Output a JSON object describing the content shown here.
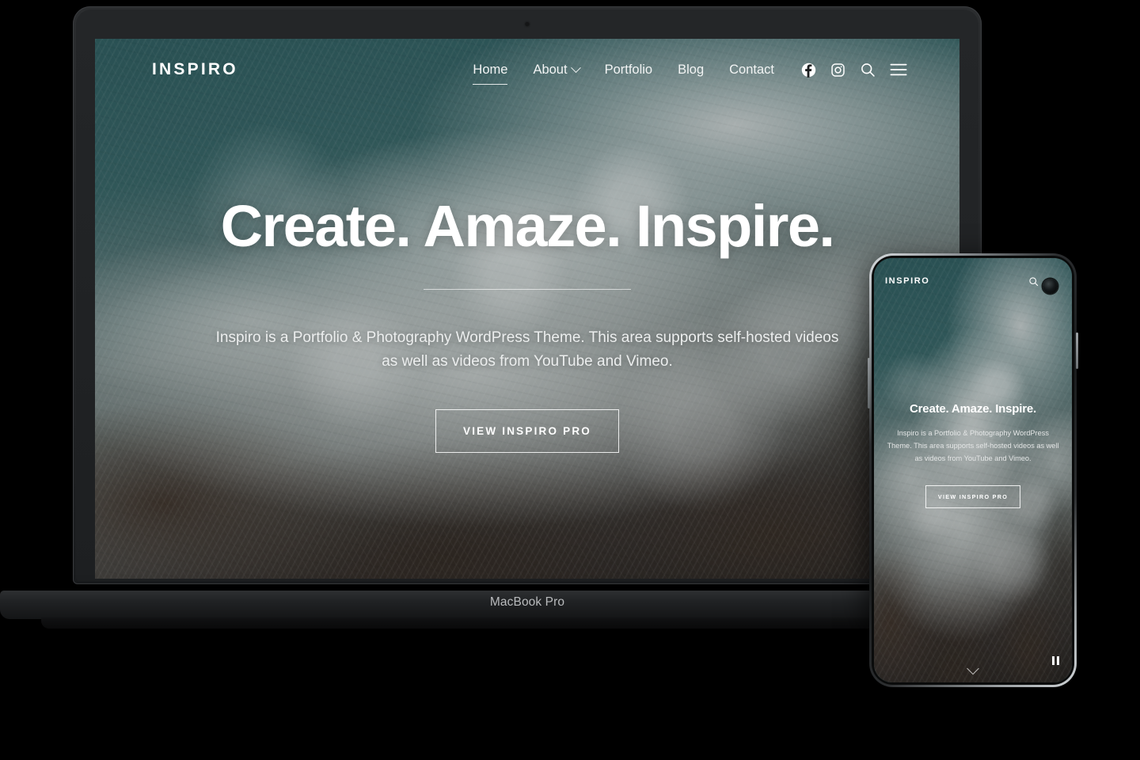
{
  "device_mockup": {
    "laptop_label": "MacBook Pro"
  },
  "site": {
    "brand": "INSPIRO",
    "nav": {
      "links": [
        {
          "label": "Home",
          "active": true,
          "has_dropdown": false
        },
        {
          "label": "About",
          "active": false,
          "has_dropdown": true
        },
        {
          "label": "Portfolio",
          "active": false,
          "has_dropdown": false
        },
        {
          "label": "Blog",
          "active": false,
          "has_dropdown": false
        },
        {
          "label": "Contact",
          "active": false,
          "has_dropdown": false
        }
      ],
      "icons": [
        "facebook-icon",
        "instagram-icon",
        "search-icon",
        "hamburger-menu-icon"
      ]
    },
    "hero": {
      "title": "Create. Amaze. Inspire.",
      "subtitle": "Inspiro is a Portfolio & Photography WordPress Theme. This area supports self-hosted videos as well as videos from YouTube and Vimeo.",
      "cta_label": "VIEW INSPIRO PRO",
      "background": "aerial ocean waves over rocks"
    }
  },
  "mobile": {
    "brand": "INSPIRO",
    "icons": [
      "search-icon"
    ],
    "hero": {
      "title": "Create. Amaze. Inspire.",
      "subtitle": "Inspiro is a Portfolio & Photography WordPress Theme. This area supports self-hosted videos as well as videos from YouTube and Vimeo.",
      "cta_label": "VIEW INSPIRO PRO"
    },
    "controls": [
      "pause-icon",
      "scroll-down-icon"
    ]
  },
  "colors": {
    "page_background": "#000000",
    "ocean_teal": "#2c5c60",
    "foam_white": "#e2e5e4",
    "rock_brown": "#3a302a",
    "text_white": "#ffffff",
    "device_body": "#232527"
  }
}
